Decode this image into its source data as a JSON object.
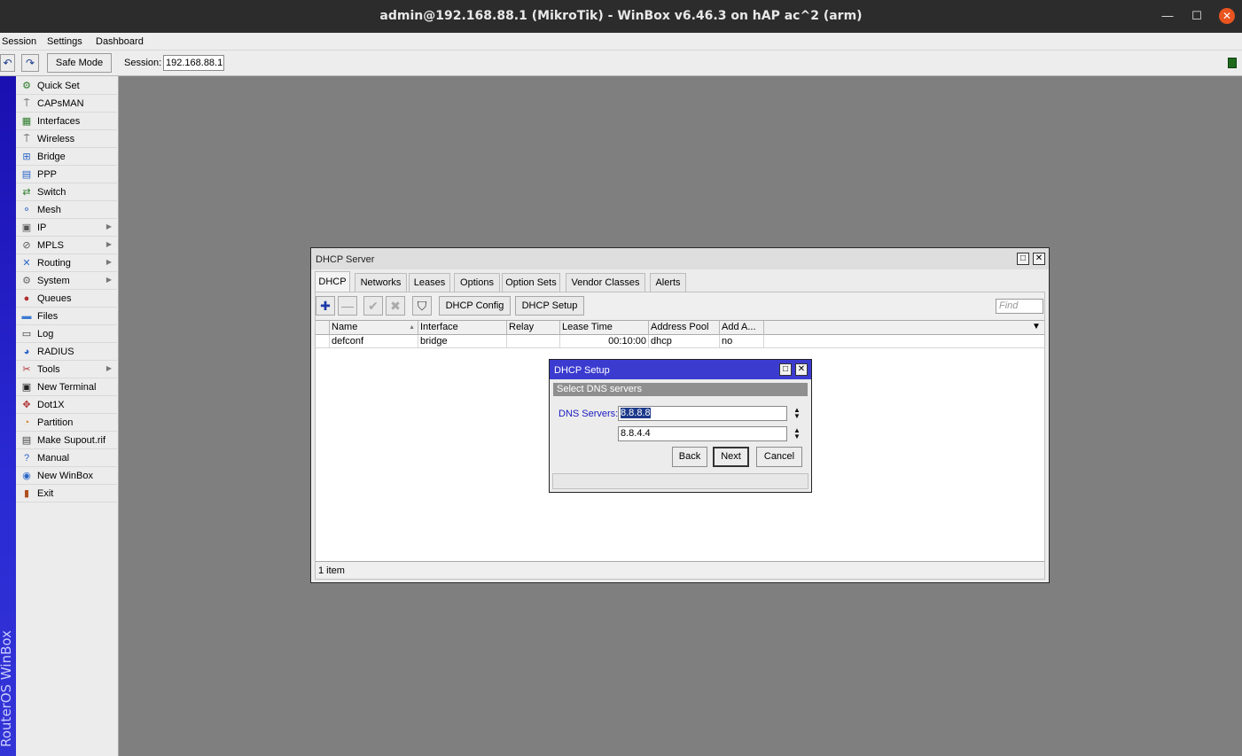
{
  "window": {
    "title": "admin@192.168.88.1 (MikroTik) - WinBox v6.46.3 on hAP ac^2 (arm)",
    "min_glyph": "—",
    "max_glyph": "☐",
    "close_glyph": "✕"
  },
  "menubar": {
    "items": [
      "Session",
      "Settings",
      "Dashboard"
    ]
  },
  "toolbar": {
    "undo_glyph": "↶",
    "redo_glyph": "↷",
    "safe_mode_label": "Safe Mode",
    "session_label": "Session:",
    "session_value": "192.168.88.1"
  },
  "brand": "RouterOS WinBox",
  "sidebar": {
    "items": [
      {
        "label": "Quick Set",
        "icon": "⚙",
        "color": "#2a7a2a"
      },
      {
        "label": "CAPsMAN",
        "icon": "⍑",
        "color": "#3a3a3a"
      },
      {
        "label": "Interfaces",
        "icon": "▦",
        "color": "#2a7a2a"
      },
      {
        "label": "Wireless",
        "icon": "⍑",
        "color": "#3a3a3a"
      },
      {
        "label": "Bridge",
        "icon": "⊞",
        "color": "#2a66c8"
      },
      {
        "label": "PPP",
        "icon": "▤",
        "color": "#2a66c8"
      },
      {
        "label": "Switch",
        "icon": "⇄",
        "color": "#2a7a2a"
      },
      {
        "label": "Mesh",
        "icon": "⚬",
        "color": "#2a66c8"
      },
      {
        "label": "IP",
        "icon": "▣",
        "color": "#555555",
        "arrow": "▶"
      },
      {
        "label": "MPLS",
        "icon": "⊘",
        "color": "#555555",
        "arrow": "▶"
      },
      {
        "label": "Routing",
        "icon": "✕",
        "color": "#2a66c8",
        "arrow": "▶"
      },
      {
        "label": "System",
        "icon": "⚙",
        "color": "#666666",
        "arrow": "▶"
      },
      {
        "label": "Queues",
        "icon": "●",
        "color": "#b03030"
      },
      {
        "label": "Files",
        "icon": "▬",
        "color": "#3a7ad0"
      },
      {
        "label": "Log",
        "icon": "▭",
        "color": "#333333"
      },
      {
        "label": "RADIUS",
        "icon": "◕",
        "color": "#2a66c8"
      },
      {
        "label": "Tools",
        "icon": "✂",
        "color": "#b03030",
        "arrow": "▶"
      },
      {
        "label": "New Terminal",
        "icon": "▣",
        "color": "#222222"
      },
      {
        "label": "Dot1X",
        "icon": "✥",
        "color": "#b03030"
      },
      {
        "label": "Partition",
        "icon": "◔",
        "color": "#d07a20"
      },
      {
        "label": "Make Supout.rif",
        "icon": "▤",
        "color": "#444444"
      },
      {
        "label": "Manual",
        "icon": "?",
        "color": "#2a66c8"
      },
      {
        "label": "New WinBox",
        "icon": "◉",
        "color": "#2a66c8"
      },
      {
        "label": "Exit",
        "icon": "▮",
        "color": "#b05020"
      }
    ]
  },
  "dhcp_server": {
    "title": "DHCP Server",
    "tabs": [
      "DHCP",
      "Networks",
      "Leases",
      "Options",
      "Option Sets",
      "Vendor Classes",
      "Alerts"
    ],
    "active_tab": "DHCP",
    "buttons": {
      "add_glyph": "✚",
      "remove_glyph": "—",
      "enable_glyph": "✔",
      "disable_glyph": "✖",
      "filter_glyph": "⛉",
      "config": "DHCP Config",
      "setup": "DHCP Setup"
    },
    "find_placeholder": "Find",
    "columns": [
      "Name",
      "Interface",
      "Relay",
      "Lease Time",
      "Address Pool",
      "Add A..."
    ],
    "sort_glyph": "▲",
    "dropdown_glyph": "▼",
    "rows": [
      {
        "name": "defconf",
        "interface": "bridge",
        "relay": "",
        "lease_time": "00:10:00",
        "address_pool": "dhcp",
        "add_arp": "no"
      }
    ],
    "status": "1 item"
  },
  "dhcp_setup": {
    "title": "DHCP Setup",
    "subtitle": "Select DNS servers",
    "dns_label": "DNS Servers:",
    "dns_primary": "8.8.8.8",
    "dns_secondary": "8.8.4.4",
    "spin_up": "▲",
    "spin_down": "▼",
    "back": "Back",
    "next": "Next",
    "cancel": "Cancel"
  }
}
